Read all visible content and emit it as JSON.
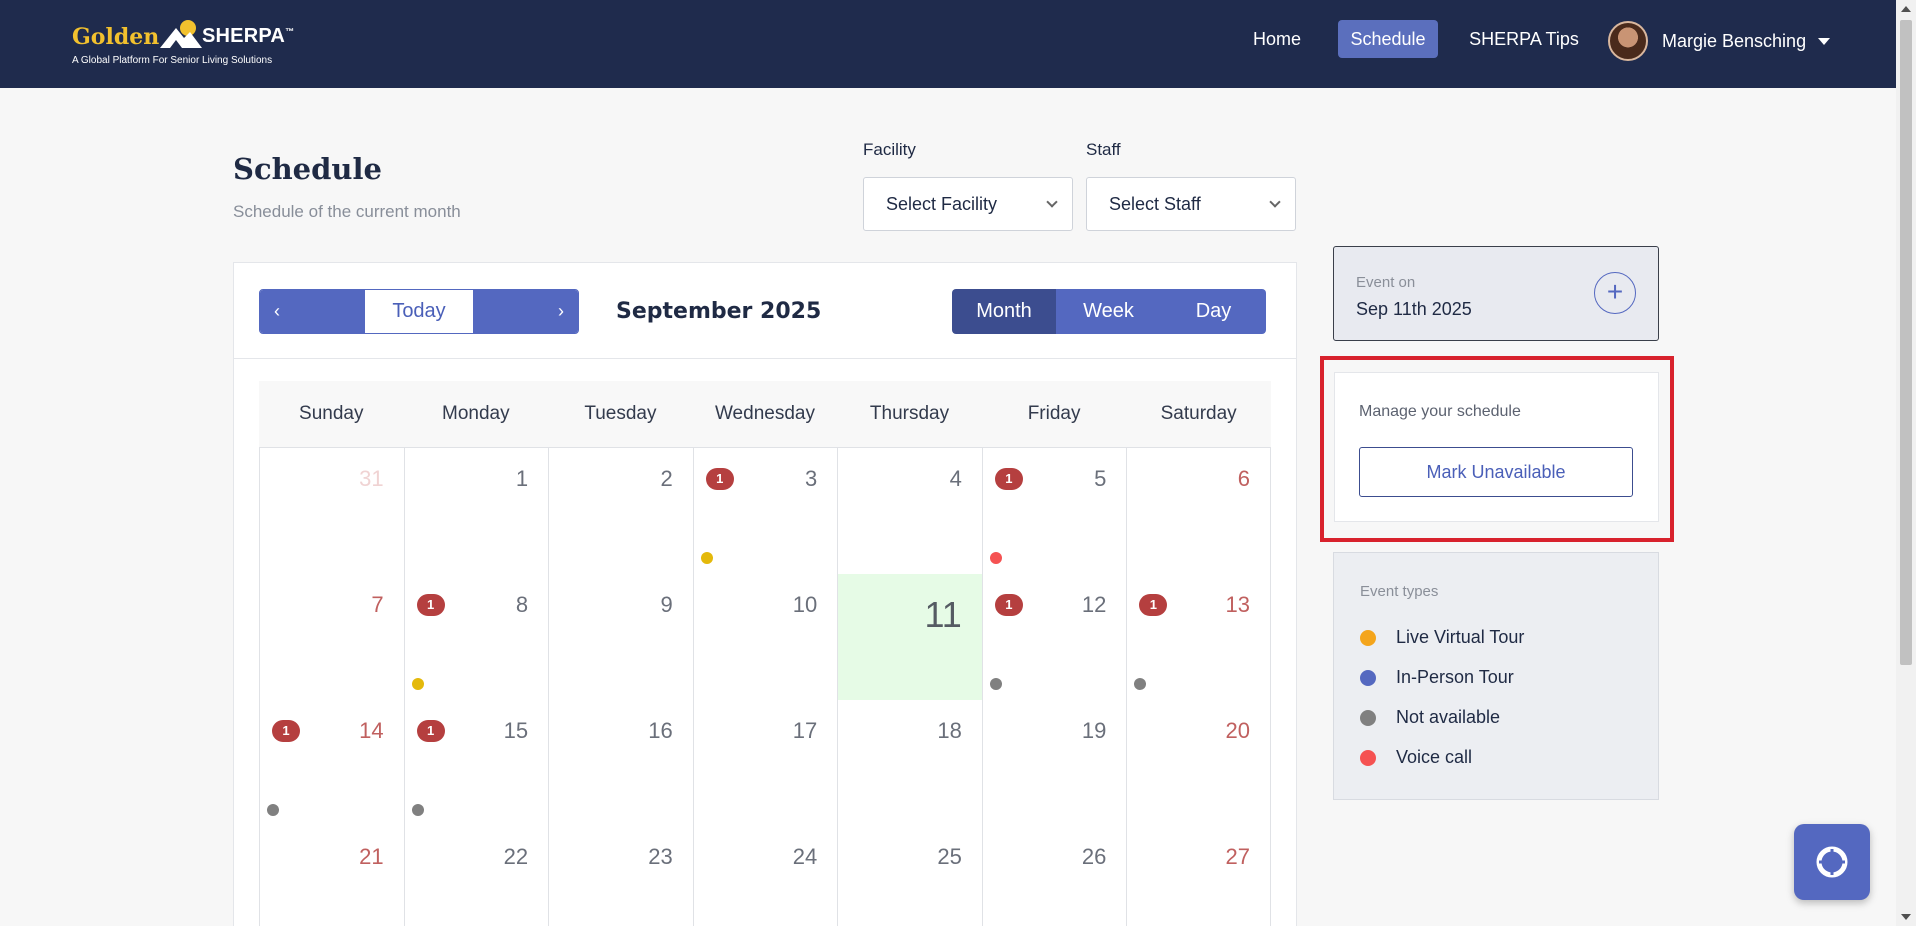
{
  "brand": {
    "word_golden": "Golden",
    "word_sherpa": "SHERPA",
    "tm": "™",
    "tagline": "A Global Platform For Senior Living Solutions"
  },
  "nav": {
    "home": "Home",
    "schedule": "Schedule",
    "tips": "SHERPA Tips",
    "user_name": "Margie Bensching"
  },
  "page": {
    "title": "Schedule",
    "subtitle": "Schedule of the current month"
  },
  "filters": {
    "facility_label": "Facility",
    "facility_value": "Select Facility",
    "staff_label": "Staff",
    "staff_value": "Select Staff"
  },
  "calendar": {
    "prev": "‹",
    "today": "Today",
    "next": "›",
    "month_title": "September 2025",
    "views": [
      "Month",
      "Week",
      "Day"
    ],
    "active_view": "Month",
    "weekdays": [
      "Sunday",
      "Monday",
      "Tuesday",
      "Wednesday",
      "Thursday",
      "Friday",
      "Saturday"
    ],
    "weeks": [
      [
        {
          "day": "31",
          "other": true
        },
        {
          "day": "1"
        },
        {
          "day": "2"
        },
        {
          "day": "3",
          "badge": "1",
          "dot": "#e4b90b"
        },
        {
          "day": "4"
        },
        {
          "day": "5",
          "badge": "1",
          "dot": "#f55252"
        },
        {
          "day": "6"
        }
      ],
      [
        {
          "day": "7"
        },
        {
          "day": "8",
          "badge": "1",
          "dot": "#e4b90b"
        },
        {
          "day": "9"
        },
        {
          "day": "10"
        },
        {
          "day": "11",
          "today": true
        },
        {
          "day": "12",
          "badge": "1",
          "dot": "#808080"
        },
        {
          "day": "13",
          "badge": "1",
          "dot": "#808080"
        }
      ],
      [
        {
          "day": "14",
          "badge": "1",
          "dot": "#808080"
        },
        {
          "day": "15",
          "badge": "1",
          "dot": "#808080"
        },
        {
          "day": "16"
        },
        {
          "day": "17"
        },
        {
          "day": "18"
        },
        {
          "day": "19"
        },
        {
          "day": "20"
        }
      ],
      [
        {
          "day": "21"
        },
        {
          "day": "22"
        },
        {
          "day": "23"
        },
        {
          "day": "24"
        },
        {
          "day": "25"
        },
        {
          "day": "26"
        },
        {
          "day": "27"
        }
      ]
    ]
  },
  "event_on": {
    "label": "Event on",
    "date": "Sep 11th 2025",
    "add": "+"
  },
  "manage": {
    "label": "Manage your schedule",
    "button": "Mark Unavailable"
  },
  "event_types": {
    "label": "Event types",
    "items": [
      {
        "name": "Live Virtual Tour",
        "color": "#f4a51c"
      },
      {
        "name": "In-Person Tour",
        "color": "#5468c0"
      },
      {
        "name": "Not available",
        "color": "#808080"
      },
      {
        "name": "Voice call",
        "color": "#f55252"
      }
    ]
  },
  "colors": {
    "header_bg": "#1f2b4d",
    "accent": "#5468c0",
    "accent_dark": "#3c4d8f",
    "today_bg": "#e6fbe6",
    "badge": "#b53f3f",
    "highlight_outline": "#d8222d"
  }
}
